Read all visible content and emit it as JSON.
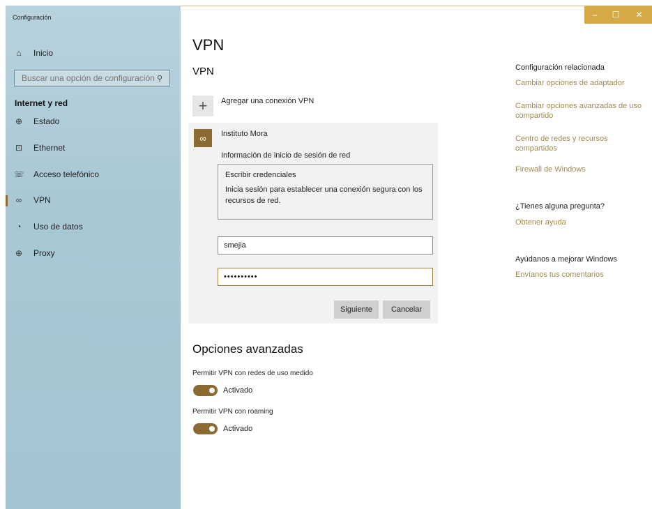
{
  "window": {
    "title": "Configuración",
    "controls": {
      "minimize": "–",
      "maximize": "☐",
      "close": "✕"
    }
  },
  "sidebar": {
    "home": {
      "label": "Inicio",
      "icon": "home-icon"
    },
    "search": {
      "placeholder": "Buscar una opción de configuración",
      "icon": "search-icon"
    },
    "section_title": "Internet y red",
    "items": [
      {
        "label": "Estado",
        "icon": "globe-status-icon",
        "glyph": "⊕"
      },
      {
        "label": "Ethernet",
        "icon": "ethernet-icon",
        "glyph": "⊡"
      },
      {
        "label": "Acceso telefónico",
        "icon": "dialup-icon",
        "glyph": "☏"
      },
      {
        "label": "VPN",
        "icon": "vpn-icon",
        "glyph": "∞",
        "active": true
      },
      {
        "label": "Uso de datos",
        "icon": "data-usage-icon",
        "glyph": "◔"
      },
      {
        "label": "Proxy",
        "icon": "proxy-globe-icon",
        "glyph": "⊕"
      }
    ]
  },
  "main": {
    "page_title": "VPN",
    "section_title": "VPN",
    "add_connection": {
      "label": "Agregar una conexión VPN",
      "icon": "plus-icon"
    },
    "connection": {
      "name": "Instituto Mora",
      "icon": "vpn-connection-icon",
      "info_label": "Información de inicio de sesión de red",
      "credentials_title": "Escribir credenciales",
      "credentials_desc": "Inicia sesión para establecer una conexión segura con los recursos de red.",
      "username_value": "smejia",
      "password_value": "••••••••••",
      "next_button": "Siguiente",
      "cancel_button": "Cancelar"
    },
    "advanced": {
      "title": "Opciones avanzadas",
      "options": [
        {
          "label": "Permitir VPN con redes de uso medido",
          "state": "Activado",
          "on": true
        },
        {
          "label": "Permitir VPN con roaming",
          "state": "Activado",
          "on": true
        }
      ]
    }
  },
  "related": {
    "heading": "Configuración relacionada",
    "links": [
      "Cambiar opciones de adaptador",
      "Cambiar opciones avanzadas de uso compartido",
      "Centro de redes y recursos compartidos",
      "Firewall de Windows"
    ],
    "question_heading": "¿Tienes alguna pregunta?",
    "help_link": "Obtener ayuda",
    "improve_heading": "Ayúdanos a mejorar Windows",
    "feedback_link": "Envíanos tus comentarios"
  },
  "colors": {
    "accent": "#8c6b33",
    "titlebar_buttons": "#d5a946",
    "sidebar": "#a9c8d4",
    "link": "#a08a4f"
  }
}
